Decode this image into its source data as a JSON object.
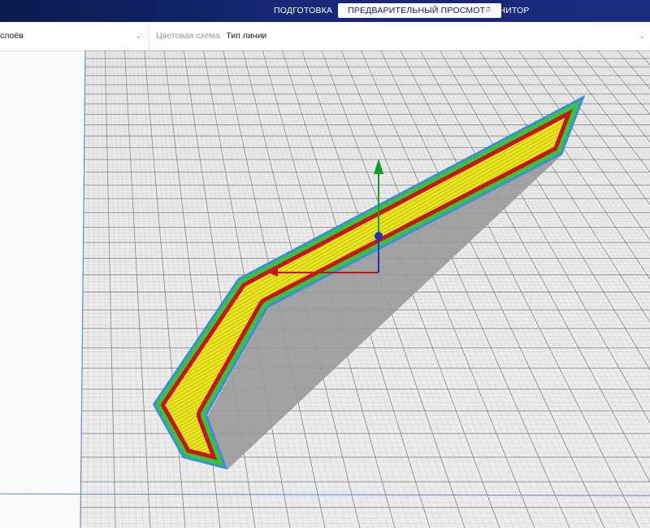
{
  "header": {
    "stages": [
      {
        "label": "ПОДГОТОВКА",
        "active": false
      },
      {
        "label": "ПРЕДВАРИТЕЛЬНЫЙ ПРОСМОТР",
        "active": true
      },
      {
        "label": "МОНИТОР",
        "active": false
      }
    ]
  },
  "toolbar": {
    "view_type_value": "слоёв",
    "color_scheme_label": "Цветовая схема",
    "color_scheme_value": "Тип линии"
  },
  "colors": {
    "header": "#12226a",
    "wall_outer": "#3b8fe0",
    "wall_inner": "#39c43a",
    "skin_red": "#c8141a",
    "infill": "#e6e21c",
    "shadow": "#9a9a9a",
    "axis_x": "#d01010",
    "axis_y": "#10a020",
    "axis_z": "#2030c0"
  }
}
